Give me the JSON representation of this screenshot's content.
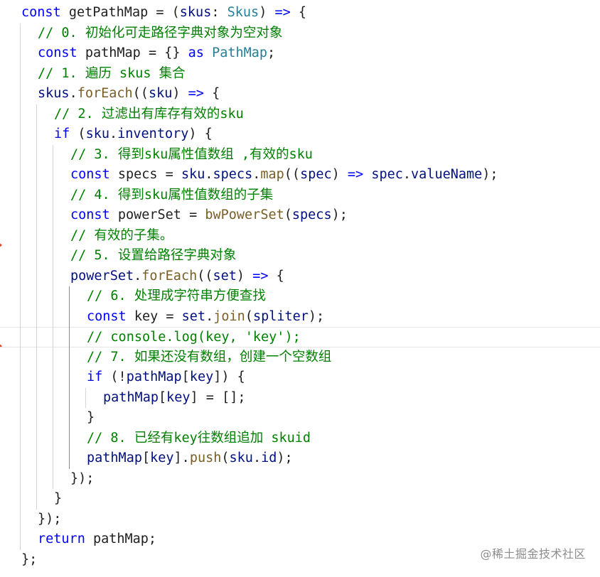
{
  "editor": {
    "language": "typescript",
    "lines": [
      {
        "indent": 0,
        "tokens": [
          [
            "kw",
            "const"
          ],
          [
            "plain",
            " getPathMap = ("
          ],
          [
            "var",
            "skus"
          ],
          [
            "plain",
            ": "
          ],
          [
            "type",
            "Skus"
          ],
          [
            "plain",
            ") "
          ],
          [
            "kw",
            "=>"
          ],
          [
            "plain",
            " {"
          ]
        ]
      },
      {
        "indent": 1,
        "tokens": [
          [
            "comment",
            "// 0. 初始化可走路径字典对象为空对象"
          ]
        ]
      },
      {
        "indent": 1,
        "tokens": [
          [
            "kw",
            "const"
          ],
          [
            "plain",
            " pathMap = {} "
          ],
          [
            "kw",
            "as"
          ],
          [
            "plain",
            " "
          ],
          [
            "type",
            "PathMap"
          ],
          [
            "plain",
            ";"
          ]
        ]
      },
      {
        "indent": 1,
        "tokens": [
          [
            "comment",
            "// 1. 遍历 skus 集合"
          ]
        ]
      },
      {
        "indent": 1,
        "tokens": [
          [
            "var",
            "skus"
          ],
          [
            "plain",
            "."
          ],
          [
            "fn",
            "forEach"
          ],
          [
            "plain",
            "(("
          ],
          [
            "var",
            "sku"
          ],
          [
            "plain",
            ") "
          ],
          [
            "kw",
            "=>"
          ],
          [
            "plain",
            " {"
          ]
        ]
      },
      {
        "indent": 2,
        "tokens": [
          [
            "comment",
            "// 2. 过滤出有库存有效的sku"
          ]
        ]
      },
      {
        "indent": 2,
        "tokens": [
          [
            "kw",
            "if"
          ],
          [
            "plain",
            " ("
          ],
          [
            "var",
            "sku"
          ],
          [
            "plain",
            "."
          ],
          [
            "var",
            "inventory"
          ],
          [
            "plain",
            ") {"
          ]
        ]
      },
      {
        "indent": 3,
        "tokens": [
          [
            "comment",
            "// 3. 得到sku属性值数组 ,有效的sku"
          ]
        ]
      },
      {
        "indent": 3,
        "tokens": [
          [
            "kw",
            "const"
          ],
          [
            "plain",
            " specs = "
          ],
          [
            "var",
            "sku"
          ],
          [
            "plain",
            "."
          ],
          [
            "var",
            "specs"
          ],
          [
            "plain",
            "."
          ],
          [
            "fn",
            "map"
          ],
          [
            "plain",
            "(("
          ],
          [
            "var",
            "spec"
          ],
          [
            "plain",
            ") "
          ],
          [
            "kw",
            "=>"
          ],
          [
            "plain",
            " "
          ],
          [
            "var",
            "spec"
          ],
          [
            "plain",
            "."
          ],
          [
            "var",
            "valueName"
          ],
          [
            "plain",
            ");"
          ]
        ]
      },
      {
        "indent": 3,
        "tokens": [
          [
            "comment",
            "// 4. 得到sku属性值数组的子集"
          ]
        ]
      },
      {
        "indent": 3,
        "tokens": [
          [
            "kw",
            "const"
          ],
          [
            "plain",
            " powerSet = "
          ],
          [
            "fn",
            "bwPowerSet"
          ],
          [
            "plain",
            "("
          ],
          [
            "var",
            "specs"
          ],
          [
            "plain",
            ");"
          ]
        ]
      },
      {
        "indent": 3,
        "tokens": [
          [
            "comment",
            "// 有效的子集。"
          ]
        ]
      },
      {
        "indent": 3,
        "tokens": [
          [
            "comment",
            "// 5. 设置给路径字典对象"
          ]
        ]
      },
      {
        "indent": 3,
        "tokens": [
          [
            "var",
            "powerSet"
          ],
          [
            "plain",
            "."
          ],
          [
            "fn",
            "forEach"
          ],
          [
            "plain",
            "(("
          ],
          [
            "var",
            "set"
          ],
          [
            "plain",
            ") "
          ],
          [
            "kw",
            "=>"
          ],
          [
            "plain",
            " {"
          ]
        ]
      },
      {
        "indent": 4,
        "tokens": [
          [
            "comment",
            "// 6. 处理成字符串方便查找"
          ]
        ]
      },
      {
        "indent": 4,
        "tokens": [
          [
            "kw",
            "const"
          ],
          [
            "plain",
            " key = "
          ],
          [
            "var",
            "set"
          ],
          [
            "plain",
            "."
          ],
          [
            "fn",
            "join"
          ],
          [
            "plain",
            "("
          ],
          [
            "var",
            "spliter"
          ],
          [
            "plain",
            ");"
          ]
        ]
      },
      {
        "indent": 4,
        "tokens": [
          [
            "comment",
            "// console.log(key, 'key');"
          ]
        ]
      },
      {
        "indent": 4,
        "tokens": [
          [
            "comment",
            "// 7. 如果还没有数组，创建一个空数组"
          ]
        ]
      },
      {
        "indent": 4,
        "tokens": [
          [
            "kw",
            "if"
          ],
          [
            "plain",
            " (!"
          ],
          [
            "var",
            "pathMap"
          ],
          [
            "plain",
            "["
          ],
          [
            "var",
            "key"
          ],
          [
            "plain",
            "]) {"
          ]
        ]
      },
      {
        "indent": 5,
        "tokens": [
          [
            "var",
            "pathMap"
          ],
          [
            "plain",
            "["
          ],
          [
            "var",
            "key"
          ],
          [
            "plain",
            "] = [];"
          ]
        ]
      },
      {
        "indent": 4,
        "tokens": [
          [
            "plain",
            "}"
          ]
        ]
      },
      {
        "indent": 4,
        "tokens": [
          [
            "comment",
            "// 8. 已经有key往数组追加 skuid"
          ]
        ]
      },
      {
        "indent": 4,
        "tokens": [
          [
            "var",
            "pathMap"
          ],
          [
            "plain",
            "["
          ],
          [
            "var",
            "key"
          ],
          [
            "plain",
            "]."
          ],
          [
            "fn",
            "push"
          ],
          [
            "plain",
            "("
          ],
          [
            "var",
            "sku"
          ],
          [
            "plain",
            "."
          ],
          [
            "var",
            "id"
          ],
          [
            "plain",
            ");"
          ]
        ]
      },
      {
        "indent": 3,
        "tokens": [
          [
            "plain",
            "});"
          ]
        ]
      },
      {
        "indent": 2,
        "tokens": [
          [
            "plain",
            "}"
          ]
        ]
      },
      {
        "indent": 1,
        "tokens": [
          [
            "plain",
            "});"
          ]
        ]
      },
      {
        "indent": 1,
        "tokens": [
          [
            "kw",
            "return"
          ],
          [
            "plain",
            " pathMap;"
          ]
        ]
      },
      {
        "indent": 0,
        "tokens": [
          [
            "plain",
            "};"
          ]
        ]
      }
    ]
  },
  "watermark": {
    "text": "@稀土掘金技术社区"
  },
  "colors": {
    "keyword": "#0000ff",
    "function": "#795e26",
    "variable": "#001080",
    "type": "#267f99",
    "comment": "#008000",
    "gutter_marker": "#d9482b"
  }
}
